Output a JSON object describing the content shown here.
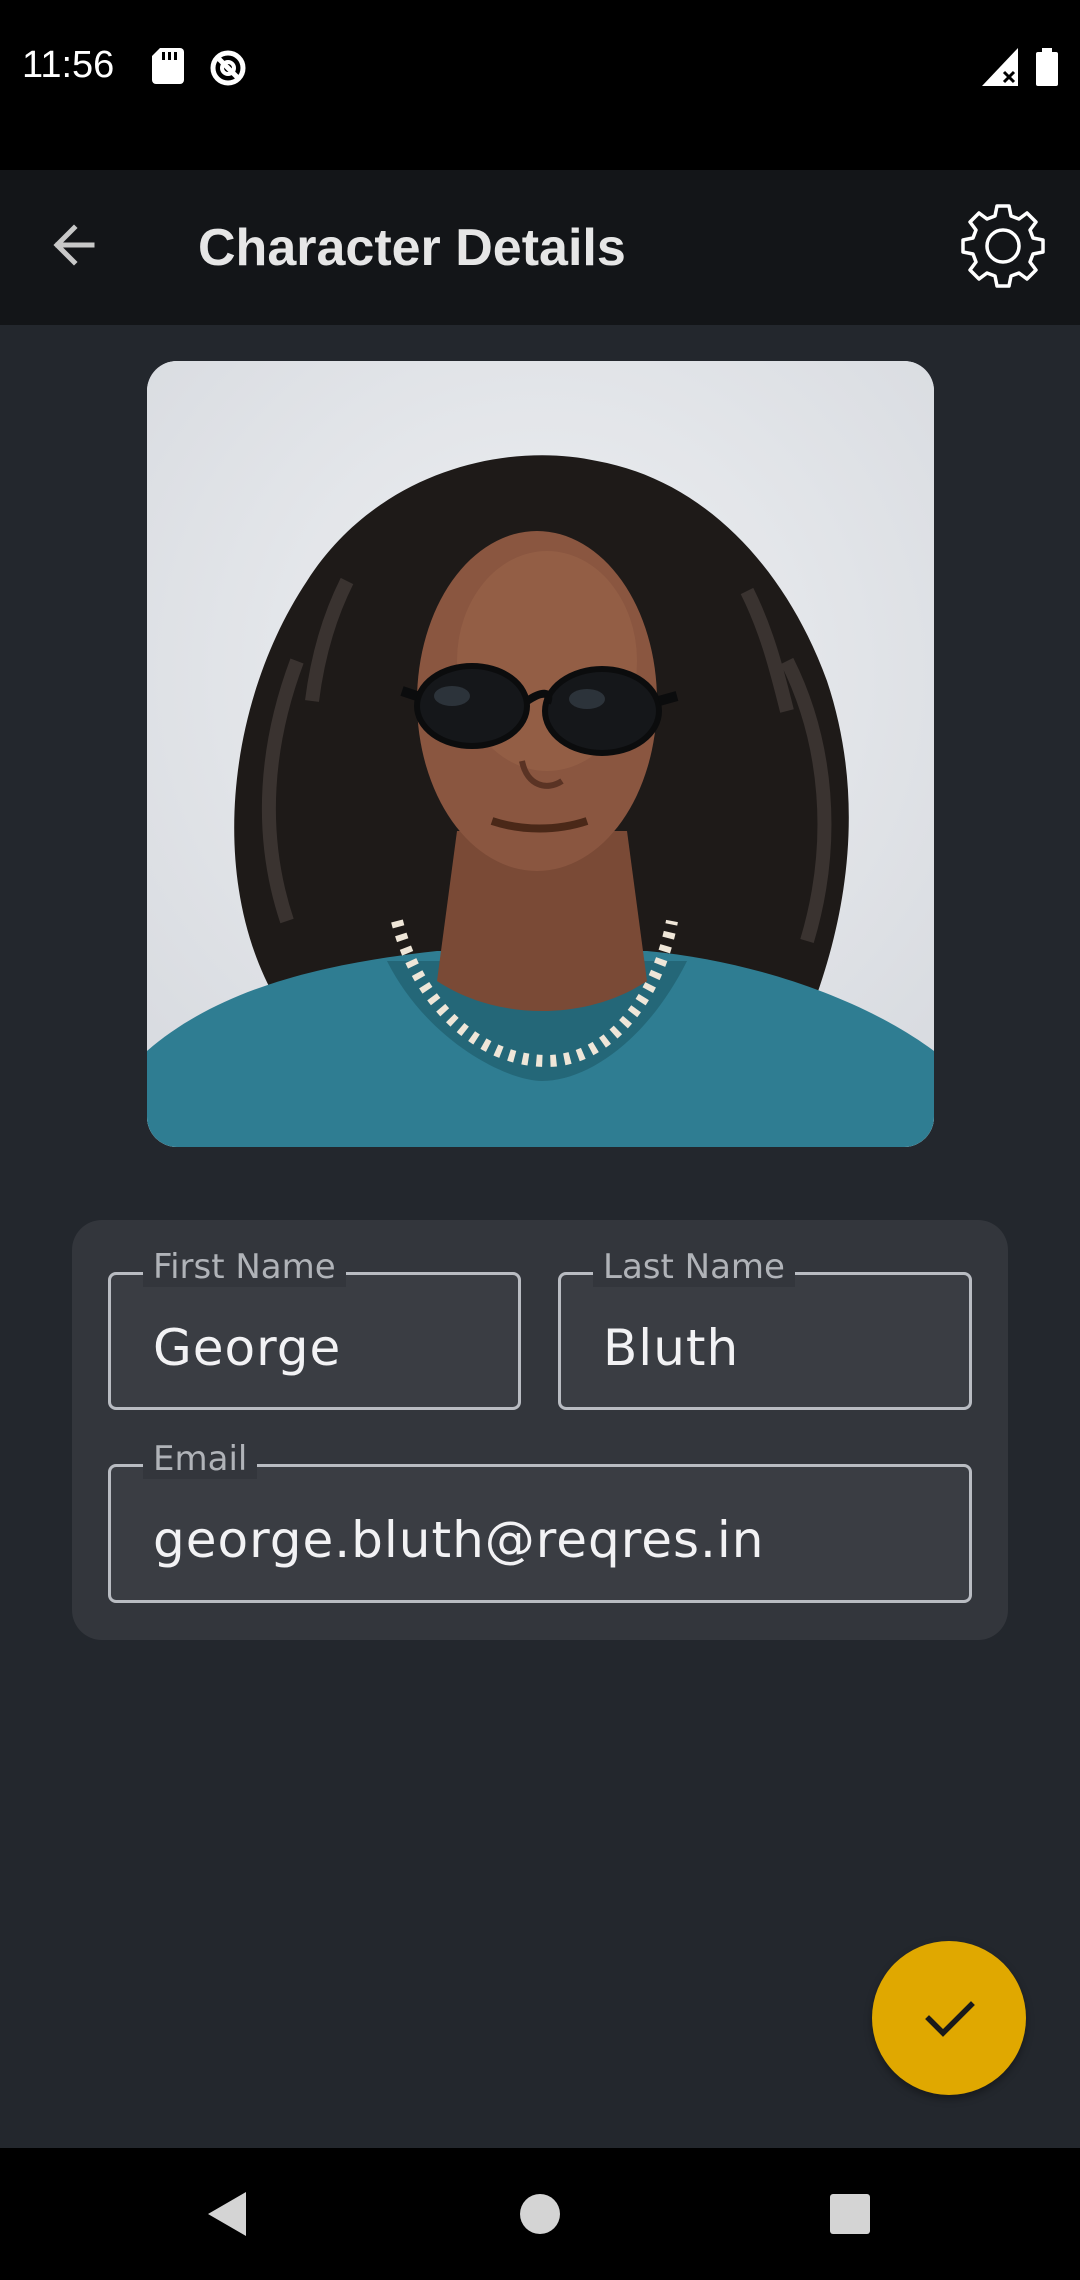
{
  "status_bar": {
    "time": "11:56",
    "icons": [
      "sd-card-icon",
      "data-saver-icon",
      "signal-icon",
      "battery-icon"
    ]
  },
  "app_bar": {
    "title": "Character Details",
    "back_icon": "arrow-left-icon",
    "settings_icon": "gear-icon"
  },
  "character": {
    "photo_alt": "profile-photo"
  },
  "form": {
    "first_name_label": "First Name",
    "first_name_value": "George",
    "last_name_label": "Last Name",
    "last_name_value": "Bluth",
    "email_label": "Email",
    "email_value": "george.bluth@reqres.in"
  },
  "fab": {
    "icon": "check-icon"
  },
  "nav_bar": {
    "back_icon": "triangle-back-icon",
    "home_icon": "circle-home-icon",
    "recents_icon": "square-recents-icon"
  },
  "colors": {
    "background": "#23272d",
    "app_bar": "#131518",
    "card": "#33363c",
    "accent": "#e0a800"
  }
}
